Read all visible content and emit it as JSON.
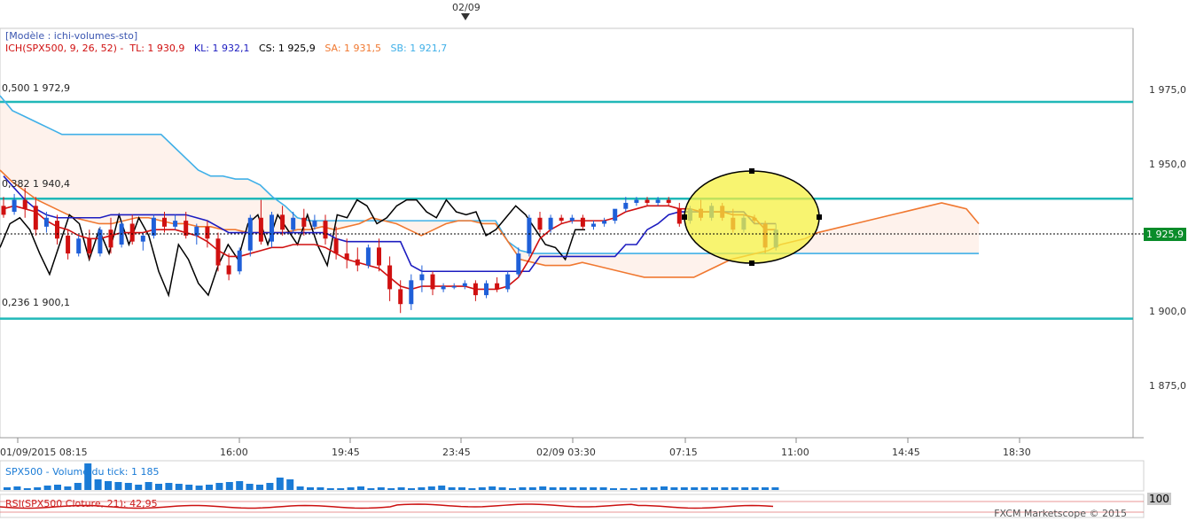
{
  "top_date": "02/09",
  "header": {
    "model": "[Modèle : ichi-volumes-sto]",
    "indicator": "ICH(SPX500, 9, 26, 52) -",
    "tl": "TL: 1 930,9",
    "kl": "KL: 1 932,1",
    "cs": "CS: 1 925,9",
    "sa": "SA: 1 931,5",
    "sb": "SB: 1 921,7"
  },
  "fib_levels": [
    {
      "label": "0,500 1 972,9",
      "value": 1972.9
    },
    {
      "label": "0,382 1 940,4",
      "value": 1940.4
    },
    {
      "label": "0,236 1 900,1",
      "value": 1900.1
    }
  ],
  "y_ticks": [
    "1 975,0",
    "1 950,0",
    "1 925,0",
    "1 900,0",
    "1 875,0"
  ],
  "x_ticks": [
    "01/09/2015 08:15",
    "16:00",
    "19:45",
    "23:45",
    "02/09 03:30",
    "07:15",
    "11:00",
    "14:45",
    "18:30"
  ],
  "current_price": "1 925,9",
  "volume_label": "SPX500 - Volume du tick: 1 185",
  "rsi_label": "RSI(SPX500.Cloture, 21): 42,95",
  "rsi_badge": "100",
  "footer": "FXCM Marketscope © 2015",
  "colors": {
    "tenkan": "#d01010",
    "kijun": "#1c1cc0",
    "chikou": "#000000",
    "senkou_a": "#f07830",
    "senkou_b": "#40b0e8",
    "fib_line": "#20b8b8",
    "candle_up": "#1f5fd8",
    "candle_down": "#d01010",
    "highlight": "#f5f040"
  },
  "chart_data": {
    "type": "candlestick",
    "y_range": [
      1855,
      1985
    ],
    "candles": [
      {
        "o": 1938,
        "h": 1941,
        "c": 1935,
        "l": 1934
      },
      {
        "o": 1936,
        "h": 1942,
        "c": 1940,
        "l": 1935
      },
      {
        "o": 1940,
        "h": 1944,
        "c": 1937,
        "l": 1934
      },
      {
        "o": 1938,
        "h": 1941,
        "c": 1930,
        "l": 1928
      },
      {
        "o": 1931,
        "h": 1936,
        "c": 1934,
        "l": 1929
      },
      {
        "o": 1933,
        "h": 1935,
        "c": 1927,
        "l": 1925
      },
      {
        "o": 1928,
        "h": 1930,
        "c": 1922,
        "l": 1920
      },
      {
        "o": 1922,
        "h": 1928,
        "c": 1927,
        "l": 1921
      },
      {
        "o": 1927,
        "h": 1930,
        "c": 1922,
        "l": 1920
      },
      {
        "o": 1922,
        "h": 1931,
        "c": 1930,
        "l": 1921
      },
      {
        "o": 1930,
        "h": 1934,
        "c": 1924,
        "l": 1922
      },
      {
        "o": 1925,
        "h": 1933,
        "c": 1932,
        "l": 1924
      },
      {
        "o": 1932,
        "h": 1935,
        "c": 1926,
        "l": 1925
      },
      {
        "o": 1926,
        "h": 1929,
        "c": 1928,
        "l": 1923
      },
      {
        "o": 1928,
        "h": 1935,
        "c": 1934,
        "l": 1927
      },
      {
        "o": 1934,
        "h": 1936,
        "c": 1931,
        "l": 1929
      },
      {
        "o": 1931,
        "h": 1935,
        "c": 1933,
        "l": 1930
      },
      {
        "o": 1933,
        "h": 1936,
        "c": 1928,
        "l": 1927
      },
      {
        "o": 1928,
        "h": 1932,
        "c": 1931,
        "l": 1925
      },
      {
        "o": 1931,
        "h": 1933,
        "c": 1927,
        "l": 1924
      },
      {
        "o": 1927,
        "h": 1929,
        "c": 1918,
        "l": 1916
      },
      {
        "o": 1918,
        "h": 1922,
        "c": 1915,
        "l": 1913
      },
      {
        "o": 1916,
        "h": 1924,
        "c": 1923,
        "l": 1915
      },
      {
        "o": 1923,
        "h": 1935,
        "c": 1934,
        "l": 1921
      },
      {
        "o": 1934,
        "h": 1940,
        "c": 1926,
        "l": 1925
      },
      {
        "o": 1926,
        "h": 1936,
        "c": 1935,
        "l": 1924
      },
      {
        "o": 1935,
        "h": 1938,
        "c": 1930,
        "l": 1928
      },
      {
        "o": 1930,
        "h": 1936,
        "c": 1934,
        "l": 1929
      },
      {
        "o": 1934,
        "h": 1937,
        "c": 1931,
        "l": 1928
      },
      {
        "o": 1931,
        "h": 1935,
        "c": 1933,
        "l": 1930
      },
      {
        "o": 1933,
        "h": 1935,
        "c": 1927,
        "l": 1925
      },
      {
        "o": 1927,
        "h": 1931,
        "c": 1922,
        "l": 1920
      },
      {
        "o": 1922,
        "h": 1927,
        "c": 1920,
        "l": 1917
      },
      {
        "o": 1920,
        "h": 1924,
        "c": 1918,
        "l": 1916
      },
      {
        "o": 1918,
        "h": 1925,
        "c": 1924,
        "l": 1917
      },
      {
        "o": 1924,
        "h": 1927,
        "c": 1918,
        "l": 1916
      },
      {
        "o": 1918,
        "h": 1921,
        "c": 1910,
        "l": 1906
      },
      {
        "o": 1910,
        "h": 1913,
        "c": 1905,
        "l": 1902
      },
      {
        "o": 1905,
        "h": 1915,
        "c": 1913,
        "l": 1903
      },
      {
        "o": 1913,
        "h": 1918,
        "c": 1915,
        "l": 1909
      },
      {
        "o": 1915,
        "h": 1916,
        "c": 1910,
        "l": 1908
      },
      {
        "o": 1910,
        "h": 1912,
        "c": 1911,
        "l": 1909
      },
      {
        "o": 1911,
        "h": 1912,
        "c": 1911,
        "l": 1910
      },
      {
        "o": 1911,
        "h": 1913,
        "c": 1912,
        "l": 1910
      },
      {
        "o": 1912,
        "h": 1913,
        "c": 1908,
        "l": 1906
      },
      {
        "o": 1908,
        "h": 1913,
        "c": 1912,
        "l": 1907
      },
      {
        "o": 1912,
        "h": 1914,
        "c": 1910,
        "l": 1909
      },
      {
        "o": 1910,
        "h": 1916,
        "c": 1915,
        "l": 1909
      },
      {
        "o": 1915,
        "h": 1924,
        "c": 1922,
        "l": 1914
      },
      {
        "o": 1922,
        "h": 1935,
        "c": 1934,
        "l": 1921
      },
      {
        "o": 1934,
        "h": 1936,
        "c": 1930,
        "l": 1929
      },
      {
        "o": 1930,
        "h": 1935,
        "c": 1934,
        "l": 1929
      },
      {
        "o": 1934,
        "h": 1935,
        "c": 1933,
        "l": 1932
      },
      {
        "o": 1933,
        "h": 1935,
        "c": 1934,
        "l": 1932
      },
      {
        "o": 1934,
        "h": 1935,
        "c": 1931,
        "l": 1930
      },
      {
        "o": 1931,
        "h": 1933,
        "c": 1932,
        "l": 1930
      },
      {
        "o": 1932,
        "h": 1934,
        "c": 1933,
        "l": 1931
      },
      {
        "o": 1933,
        "h": 1935,
        "c": 1937,
        "l": 1932
      },
      {
        "o": 1937,
        "h": 1941,
        "c": 1939,
        "l": 1936
      },
      {
        "o": 1939,
        "h": 1941,
        "c": 1940,
        "l": 1938
      },
      {
        "o": 1940,
        "h": 1941,
        "c": 1939,
        "l": 1938
      },
      {
        "o": 1939,
        "h": 1941,
        "c": 1940,
        "l": 1938
      },
      {
        "o": 1940,
        "h": 1941,
        "c": 1939,
        "l": 1938
      },
      {
        "o": 1937,
        "h": 1939,
        "c": 1932,
        "l": 1931
      },
      {
        "o": 1933,
        "h": 1938,
        "c": 1937,
        "l": 1932
      },
      {
        "o": 1937,
        "h": 1940,
        "c": 1934,
        "l": 1933
      },
      {
        "o": 1934,
        "h": 1939,
        "c": 1938,
        "l": 1933
      },
      {
        "o": 1938,
        "h": 1939,
        "c": 1934,
        "l": 1933
      },
      {
        "o": 1934,
        "h": 1937,
        "c": 1930,
        "l": 1929
      },
      {
        "o": 1930,
        "h": 1935,
        "c": 1934,
        "l": 1929
      },
      {
        "o": 1934,
        "h": 1935,
        "c": 1933,
        "l": 1932
      },
      {
        "o": 1932,
        "h": 1933,
        "c": 1924,
        "l": 1922
      },
      {
        "o": 1924,
        "h": 1932,
        "c": 1930,
        "l": 1923
      }
    ],
    "tenkan": [
      1937,
      1938,
      1937,
      1936,
      1933,
      1931,
      1930,
      1928,
      1927,
      1927,
      1928,
      1929,
      1929,
      1929,
      1930,
      1930,
      1930,
      1929,
      1928,
      1926,
      1923,
      1921,
      1921,
      1922,
      1923,
      1924,
      1924,
      1925,
      1925,
      1925,
      1924,
      1922,
      1920,
      1919,
      1918,
      1917,
      1914,
      1911,
      1910,
      1911,
      1911,
      1911,
      1911,
      1911,
      1910,
      1910,
      1910,
      1911,
      1914,
      1920,
      1927,
      1930,
      1932,
      1933,
      1933,
      1933,
      1933,
      1934,
      1936,
      1937,
      1938,
      1938,
      1938,
      1937,
      1937,
      1936,
      1936,
      1936,
      1935,
      1935,
      1934,
      1930,
      1930
    ],
    "kijun": [
      1948,
      1944,
      1940,
      1937,
      1935,
      1934,
      1934,
      1934,
      1934,
      1934,
      1935,
      1935,
      1935,
      1935,
      1935,
      1935,
      1935,
      1935,
      1934,
      1933,
      1931,
      1929,
      1929,
      1929,
      1929,
      1929,
      1929,
      1929,
      1929,
      1929,
      1929,
      1927,
      1926,
      1926,
      1926,
      1926,
      1926,
      1926,
      1918,
      1916,
      1916,
      1916,
      1916,
      1916,
      1916,
      1916,
      1916,
      1916,
      1916,
      1916,
      1921,
      1921,
      1921,
      1921,
      1921,
      1921,
      1921,
      1921,
      1925,
      1925,
      1930,
      1932,
      1935,
      1936,
      1936,
      1936,
      1936,
      1936,
      1936,
      1936,
      1932,
      1932,
      1932
    ],
    "chikou": [
      1924,
      1932,
      1934,
      1930,
      1922,
      1915,
      1925,
      1935,
      1932,
      1920,
      1930,
      1922,
      1935,
      1925,
      1934,
      1928,
      1916,
      1908,
      1925,
      1920,
      1912,
      1908,
      1918,
      1925,
      1920,
      1932,
      1935,
      1925,
      1935,
      1930,
      1925,
      1935,
      1925,
      1918,
      1935,
      1934,
      1940,
      1938,
      1932,
      1934,
      1938,
      1940,
      1940,
      1936,
      1934,
      1940,
      1936,
      1935,
      1936,
      1928,
      1930,
      1934,
      1938,
      1935,
      1930,
      1925,
      1924,
      1920,
      1930,
      1930
    ],
    "senkou_a": [
      1950,
      1946,
      1943,
      1940,
      1938,
      1936,
      1934,
      1933,
      1932,
      1932,
      1933,
      1934,
      1934,
      1933,
      1932,
      1932,
      1931,
      1931,
      1930,
      1930,
      1929,
      1929,
      1929,
      1929,
      1930,
      1930,
      1931,
      1930,
      1931,
      1932,
      1934,
      1933,
      1932,
      1930,
      1928,
      1930,
      1932,
      1933,
      1933,
      1932,
      1932,
      1926,
      1920,
      1919,
      1918,
      1918,
      1918,
      1919,
      1918,
      1917,
      1916,
      1915,
      1914,
      1914,
      1914,
      1914,
      1914,
      1916,
      1918,
      1920,
      1921,
      1922,
      1923,
      1925,
      1926,
      1927,
      1929,
      1930,
      1931,
      1932,
      1933,
      1934,
      1935,
      1936,
      1937,
      1938,
      1939,
      1938,
      1937,
      1932
    ],
    "senkou_b": [
      1975,
      1970,
      1968,
      1966,
      1964,
      1962,
      1962,
      1962,
      1962,
      1962,
      1962,
      1962,
      1962,
      1962,
      1958,
      1954,
      1950,
      1948,
      1948,
      1947,
      1947,
      1945,
      1941,
      1938,
      1934,
      1933,
      1933,
      1933,
      1933,
      1933,
      1933,
      1933,
      1933,
      1933,
      1933,
      1933,
      1933,
      1933,
      1933,
      1933,
      1933,
      1926,
      1923,
      1922,
      1922,
      1922,
      1922,
      1922,
      1922,
      1922,
      1922,
      1922,
      1922,
      1922,
      1922,
      1922,
      1922,
      1922,
      1922,
      1922,
      1922,
      1922,
      1922,
      1922,
      1922,
      1922,
      1922,
      1922,
      1922,
      1922,
      1922,
      1922,
      1922,
      1922,
      1922,
      1922,
      1922,
      1922,
      1922,
      1922
    ],
    "volume": [
      3,
      4,
      2,
      3,
      5,
      6,
      4,
      8,
      30,
      12,
      10,
      9,
      8,
      6,
      9,
      7,
      8,
      7,
      6,
      5,
      6,
      8,
      9,
      10,
      7,
      6,
      8,
      14,
      12,
      4,
      3,
      3,
      2,
      2,
      3,
      4,
      2,
      3,
      2,
      3,
      2,
      3,
      4,
      5,
      3,
      3,
      2,
      3,
      4,
      3,
      2,
      3,
      3,
      4,
      3,
      3,
      3,
      3,
      3,
      3,
      2,
      2,
      2,
      3,
      3,
      4,
      3,
      3,
      3,
      3,
      3,
      3,
      3,
      3,
      3,
      3,
      3
    ]
  }
}
